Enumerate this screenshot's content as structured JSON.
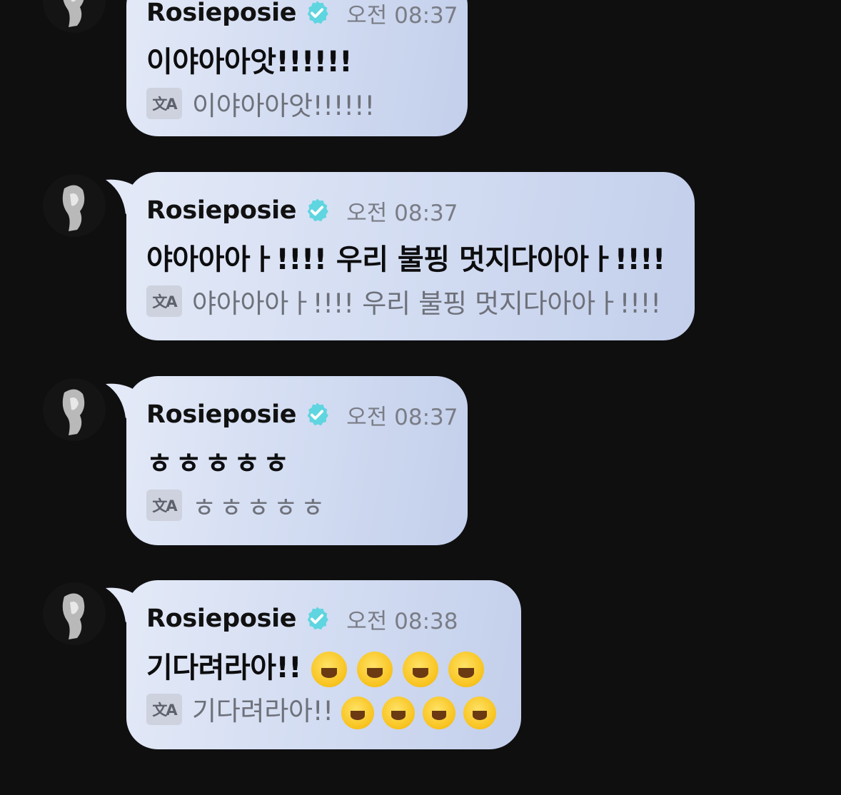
{
  "messages": [
    {
      "sender": "Rosieposie",
      "time": "오전 08:37",
      "text": "이야아아앗!!!!!!",
      "translation": "이야아아앗!!!!!!",
      "emoji_count": 0
    },
    {
      "sender": "Rosieposie",
      "time": "오전 08:37",
      "text": "야아아아ㅏ!!!! 우리 불핑 멋지다아아ㅏ!!!!",
      "translation": "야아아아ㅏ!!!! 우리 불핑 멋지다아아ㅏ!!!!",
      "emoji_count": 0
    },
    {
      "sender": "Rosieposie",
      "time": "오전 08:37",
      "text": "ㅎㅎㅎㅎㅎ",
      "translation": "ㅎㅎㅎㅎㅎ",
      "emoji_count": 0
    },
    {
      "sender": "Rosieposie",
      "time": "오전 08:38",
      "text": "기다려라아!!",
      "translation": "기다려라아!!",
      "emoji": "rolling-on-floor-laughing",
      "emoji_count": 4
    }
  ],
  "icons": {
    "verified": "verified-badge-icon",
    "translate": "translate-icon",
    "translate_glyph": "文A"
  },
  "colors": {
    "background": "#0f0f10",
    "verified": "#5fd5e0",
    "bubble_start": "#e3e9f7",
    "bubble_end": "#c3cfeb",
    "time_text": "#7a7d86"
  }
}
